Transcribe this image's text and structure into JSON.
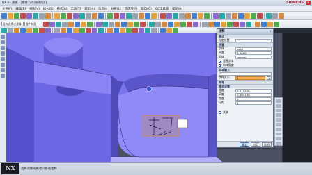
{
  "window": {
    "title": "NX 8 - 建模 - [零件.prt (修改的) ]",
    "brand": "SIEMENS",
    "close_glyph": "✕"
  },
  "menubar": {
    "items": [
      "文件(F)",
      "编辑(E)",
      "视图(V)",
      "插入(S)",
      "格式(R)",
      "工具(T)",
      "装配(A)",
      "信息(I)",
      "分析(L)",
      "首选项(P)",
      "窗口(O)",
      "GC工具箱",
      "帮助(H)"
    ]
  },
  "toolbar2": {
    "filter_combo": "没有选择过滤器",
    "scope_combo": "整个装配"
  },
  "dialog": {
    "title": "注释",
    "close": "×",
    "sections": {
      "origin": "原点",
      "style": "设置",
      "text": "文本输入",
      "symbols": "符号",
      "format": "格式设置"
    },
    "rows": [
      {
        "label": "指定位置",
        "value": ""
      },
      {
        "label": "字体",
        "value": "kanji"
      },
      {
        "label": "高度",
        "value": "3.5000"
      },
      {
        "label": "粗体",
        "value": "normal"
      }
    ],
    "checkboxes": [
      {
        "label": "竖直文本",
        "checked": true
      },
      {
        "label": "斜体角度",
        "checked": true
      }
    ],
    "text_value": "T",
    "selected_field": "字符大小",
    "selected_value": "3",
    "numeric_rows": [
      {
        "label": "宽度",
        "value": "0.579256"
      },
      {
        "label": "高度",
        "value": "0.394130"
      },
      {
        "label": "角度",
        "value": "0"
      },
      {
        "label": "行距",
        "value": "1"
      }
    ],
    "bottom_checkbox": {
      "label": "关联",
      "checked": true
    },
    "buttons": {
      "ok": "确定",
      "apply": "应用",
      "cancel": "取消"
    }
  },
  "statusbar": {
    "message": "选择对象或拖动以移动注释",
    "logo_text": "NX"
  },
  "colors": {
    "model_face": "#7a74ee",
    "model_dark": "#4c47b8",
    "model_light": "#a39dfb",
    "accent_orange": "#f3b463",
    "viewport_bg": "#4b5163"
  }
}
